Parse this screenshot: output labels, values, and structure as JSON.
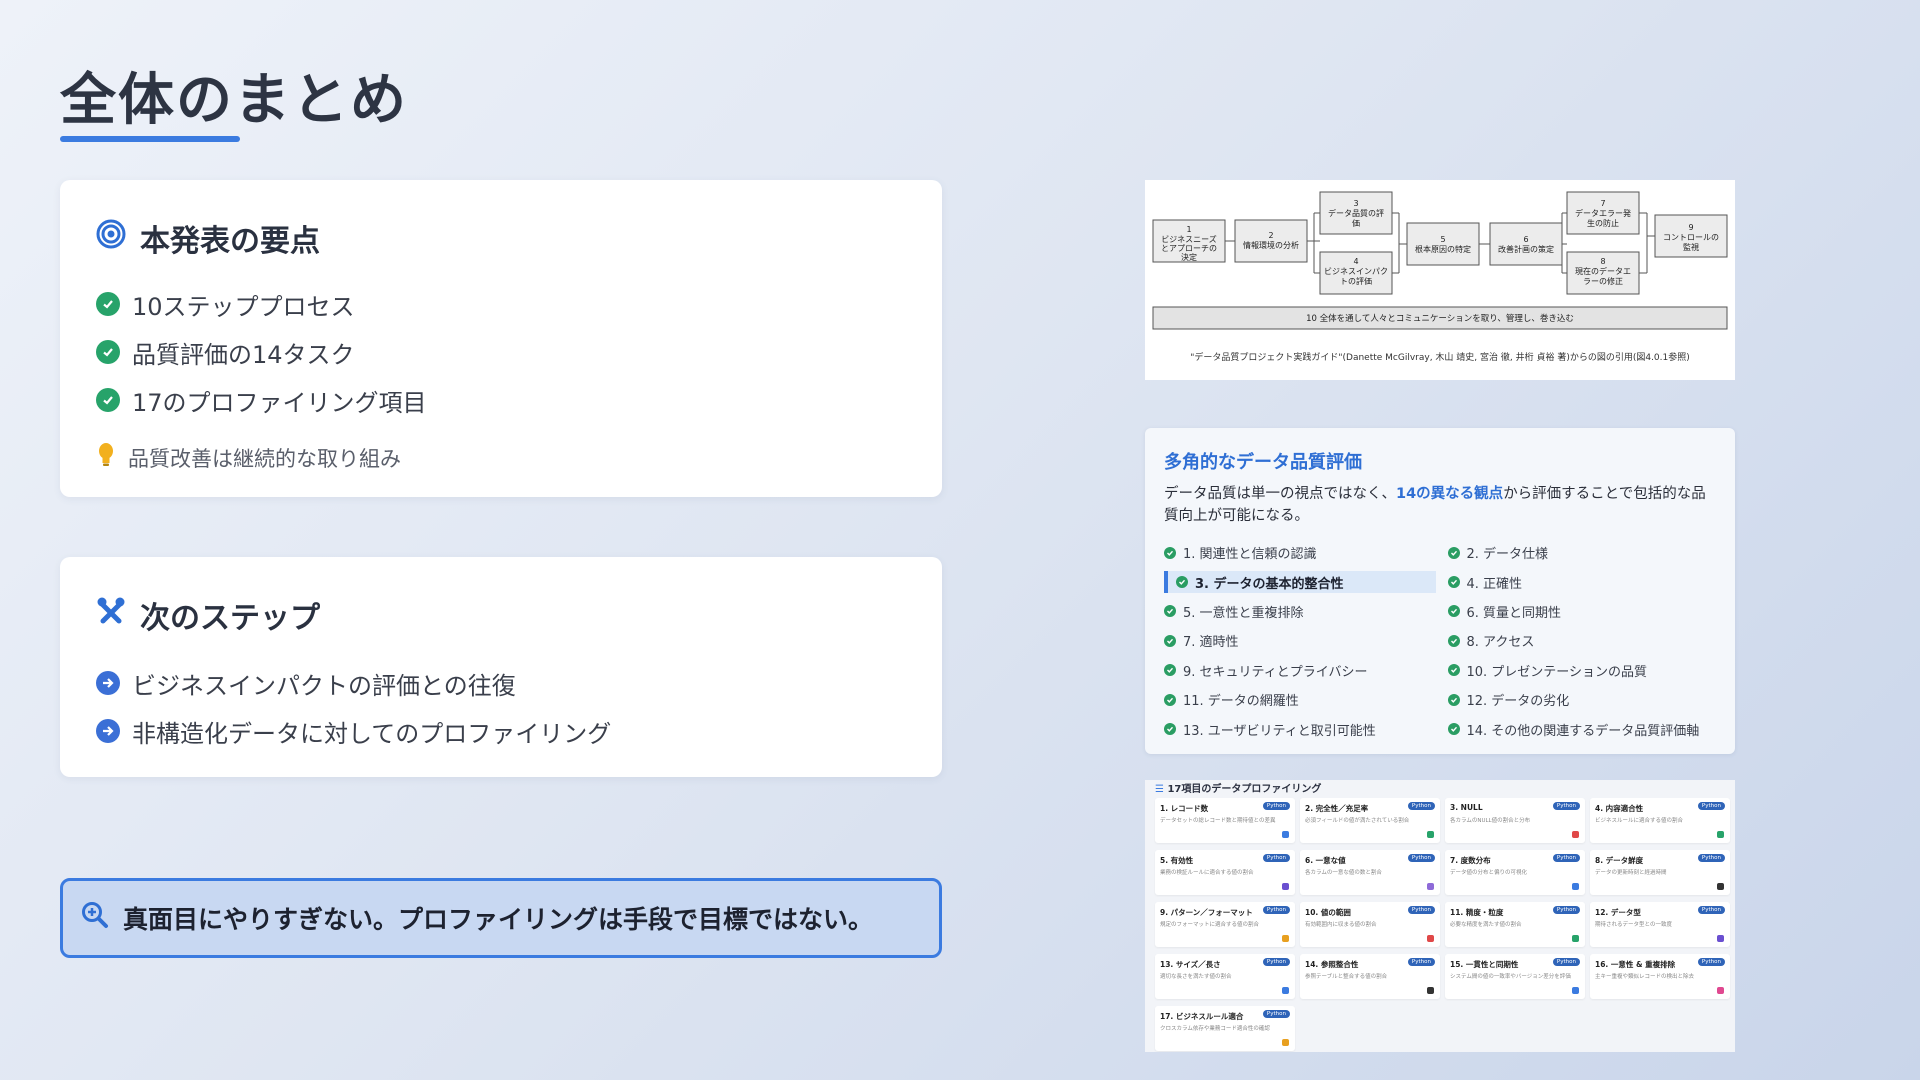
{
  "title": "全体のまとめ",
  "summary": {
    "heading": "本発表の要点",
    "items": [
      "10ステッププロセス",
      "品質評価の14タスク",
      "17のプロファイリング項目"
    ],
    "tip": "品質改善は継続的な取り組み"
  },
  "next": {
    "heading": "次のステップ",
    "items": [
      "ビジネスインパクトの評価との往復",
      "非構造化データに対してのプロファイリング"
    ]
  },
  "callout": "真面目にやりすぎない。プロファイリングは手段で目標ではない。",
  "flow": {
    "steps": [
      "1\nビジネスニーズとアプローチの決定",
      "2\n情報環境の分析",
      "3\nデータ品質の評価",
      "4\nビジネスインパクトの評価",
      "5\n根本原因の特定",
      "6\n改善計画の策定",
      "7\nデータエラー発生の防止",
      "8\n現在のデータエラーの修正",
      "9\nコントロールの監視"
    ],
    "bar": "10 全体を通して人々とコミュニケーションを取り、管理し、巻き込む",
    "caption": "\"データ品質プロジェクト実践ガイド\"(Danette McGilvray, 木山 靖史, 宮治 徹, 井桁 貞裕 著)からの図の引用(図4.0.1参照)"
  },
  "dq": {
    "title": "多角的なデータ品質評価",
    "desc_pre": "データ品質は単一の視点ではなく、",
    "desc_hl": "14の異なる観点",
    "desc_post": "から評価することで包括的な品質向上が可能になる。",
    "items": [
      "1. 関連性と信頼の認識",
      "2. データ仕様",
      "3. データの基本的整合性",
      "4. 正確性",
      "5. 一意性と重複排除",
      "6. 質量と同期性",
      "7. 適時性",
      "8. アクセス",
      "9. セキュリティとプライバシー",
      "10. プレゼンテーションの品質",
      "11. データの網羅性",
      "12. データの劣化",
      "13. ユーザビリティと取引可能性",
      "14. その他の関連するデータ品質評価軸"
    ]
  },
  "prof": {
    "title": "17項目のデータプロファイリング",
    "badge": "Python",
    "items": [
      {
        "name": "1. レコード数",
        "desc": "データセットの総レコード数と期待値との差異",
        "color": "#3b7be0"
      },
      {
        "name": "2. 完全性／充足率",
        "desc": "必須フィールドの値が満たされている割合",
        "color": "#27a36a"
      },
      {
        "name": "3. NULL",
        "desc": "各カラムのNULL値の割合と分布",
        "color": "#e04848"
      },
      {
        "name": "4. 内容適合性",
        "desc": "ビジネスルールに適合する値の割合",
        "color": "#27a36a"
      },
      {
        "name": "5. 有効性",
        "desc": "業務の検証ルールに適合する値の割合",
        "color": "#6a4fd0"
      },
      {
        "name": "6. 一意な値",
        "desc": "各カラムの一意な値の数と割合",
        "color": "#8e6ad8"
      },
      {
        "name": "7. 度数分布",
        "desc": "データ値の分布と偏りの可視化",
        "color": "#3b7be0"
      },
      {
        "name": "8. データ鮮度",
        "desc": "データの更新時刻と経過時間",
        "color": "#333333"
      },
      {
        "name": "9. パターン／フォーマット",
        "desc": "規定のフォーマットに適合する値の割合",
        "color": "#e8a020"
      },
      {
        "name": "10. 値の範囲",
        "desc": "有効範囲内に収まる値の割合",
        "color": "#e04848"
      },
      {
        "name": "11. 精度・粒度",
        "desc": "必要な精度を満たす値の割合",
        "color": "#27a36a"
      },
      {
        "name": "12. データ型",
        "desc": "期待されるデータ型との一致度",
        "color": "#6a4fd0"
      },
      {
        "name": "13. サイズ／長さ",
        "desc": "適切な長さを満たす値の割合",
        "color": "#3b7be0"
      },
      {
        "name": "14. 参照整合性",
        "desc": "参照テーブルと整合する値の割合",
        "color": "#333333"
      },
      {
        "name": "15. 一貫性と同期性",
        "desc": "システム間の値の一致率やバージョン差分を評価",
        "color": "#3b7be0"
      },
      {
        "name": "16. 一意性 & 重複排除",
        "desc": "主キー重複や類似レコードの検出と除去",
        "color": "#e04890"
      },
      {
        "name": "17. ビジネスルール適合",
        "desc": "クロスカラム依存や業務コード適合性の確認",
        "color": "#e8a020"
      }
    ]
  }
}
